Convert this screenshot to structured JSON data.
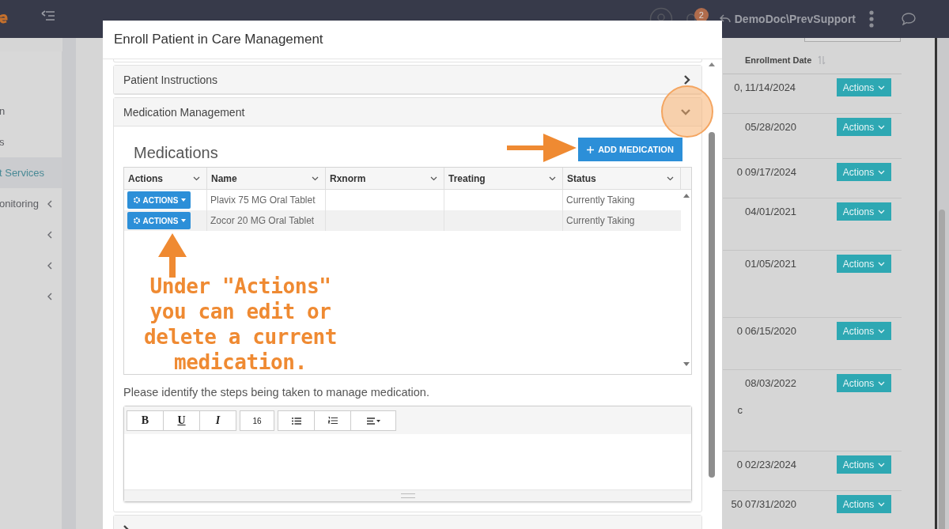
{
  "topbar": {
    "notification_count": "2",
    "user": "DemoDoc\\PrevSupport"
  },
  "sidebar": {
    "items": [
      {
        "label": "n",
        "selected": false,
        "has_submenu": false
      },
      {
        "label": "s",
        "selected": false,
        "has_submenu": false
      },
      {
        "label": "t Services",
        "selected": true,
        "has_submenu": false
      },
      {
        "label": "onitoring",
        "selected": false,
        "has_submenu": true
      },
      {
        "selected": false,
        "has_submenu": true
      },
      {
        "selected": false,
        "has_submenu": true
      },
      {
        "selected": false,
        "has_submenu": true
      }
    ]
  },
  "background_table": {
    "columns": [
      {
        "label": "Enrollment Date"
      }
    ],
    "rows": [
      {
        "column_1": "0,",
        "enrollment_date": "11/14/2024",
        "action": "Actions"
      },
      {
        "enrollment_date": "05/28/2020",
        "action": "Actions"
      },
      {
        "column_1": "0",
        "enrollment_date": "09/17/2024",
        "action": "Actions"
      },
      {
        "enrollment_date": "04/01/2021",
        "action": "Actions"
      },
      {
        "enrollment_date": "01/05/2021",
        "action": "Actions"
      },
      {
        "column_1": "0",
        "enrollment_date": "06/15/2020",
        "action": "Actions"
      },
      {
        "column_1": "c",
        "enrollment_date": "08/03/2022",
        "action": "Actions"
      },
      {
        "column_1": "0",
        "enrollment_date": "02/23/2024",
        "action": "Actions"
      },
      {
        "column_1": "50",
        "enrollment_date": "07/31/2020",
        "action": "Actions"
      }
    ]
  },
  "modal": {
    "title": "Enroll Patient in Care Management",
    "sections": [
      {
        "title": "Patient Instructions",
        "expanded": false,
        "highlighted": false
      },
      {
        "title": "Medication Management",
        "expanded": true,
        "highlighted": true
      },
      {
        "expanded": false,
        "highlighted": false
      }
    ],
    "medications": {
      "heading": "Medications",
      "add_button": "ADD MEDICATION",
      "columns": [
        {
          "label": "Actions"
        },
        {
          "label": "Name"
        },
        {
          "label": "Rxnorm"
        },
        {
          "label": "Treating"
        },
        {
          "label": "Status"
        }
      ],
      "rows": [
        {
          "action": "ACTIONS",
          "name": "Plavix 75 MG Oral Tablet",
          "status": "Currently Taking"
        },
        {
          "action": "ACTIONS",
          "name": "Zocor 20 MG Oral Tablet",
          "status": "Currently Taking"
        }
      ],
      "annotation": "Under \"Actions\"\nyou can edit or\ndelete a current\nmedication."
    },
    "steps_label": "Please identify the steps being taken to manage medication.",
    "editor": {
      "toolbar": [
        {
          "kind": "bold",
          "label": "B"
        },
        {
          "kind": "underline",
          "label": "U"
        },
        {
          "kind": "italic",
          "label": "I"
        },
        {
          "kind": "size",
          "label": "16"
        },
        {
          "kind": "bullets"
        },
        {
          "kind": "numbers"
        },
        {
          "kind": "align"
        }
      ]
    }
  }
}
